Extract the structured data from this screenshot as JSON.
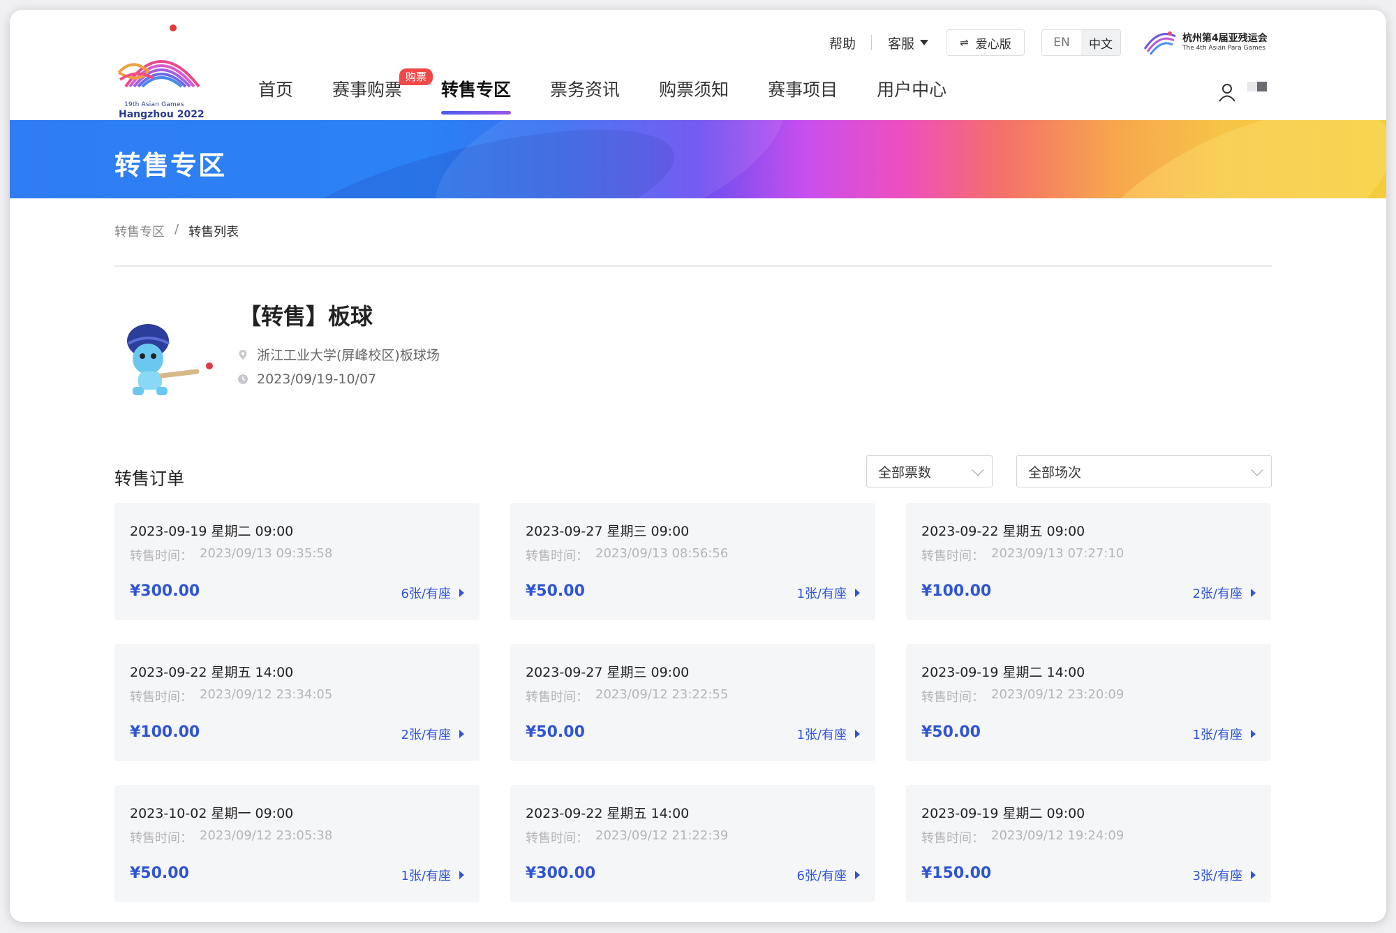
{
  "header": {
    "logo_line1": "19th Asian Games",
    "logo_line2": "Hangzhou 2022",
    "help_label": "帮助",
    "service_label": "客服",
    "love_label": "爱心版",
    "lang_en": "EN",
    "lang_cn": "中文",
    "para_games_cn": "杭州第4届亚残运会",
    "para_games_en": "The 4th Asian Para Games"
  },
  "nav": {
    "items": [
      {
        "label": "首页"
      },
      {
        "label": "赛事购票",
        "badge": "购票"
      },
      {
        "label": "转售专区"
      },
      {
        "label": "票务资讯"
      },
      {
        "label": "购票须知"
      },
      {
        "label": "赛事项目"
      },
      {
        "label": "用户中心"
      }
    ],
    "active": "转售专区"
  },
  "banner": {
    "title": "转售专区"
  },
  "breadcrumb": {
    "root": "转售专区",
    "separator": "/",
    "current": "转售列表"
  },
  "event": {
    "title": "【转售】板球",
    "venue": "浙江工业大学(屏峰校区)板球场",
    "dates": "2023/09/19-10/07"
  },
  "orders": {
    "section_title": "转售订单",
    "filter_count": "全部票数",
    "filter_session": "全部场次",
    "time_label": "转售时间：",
    "cards": [
      {
        "date": "2023-09-19 星期二 09:00",
        "sale_time": "2023/09/13 09:35:58",
        "price": "¥300.00",
        "qty": "6张/有座"
      },
      {
        "date": "2023-09-27 星期三 09:00",
        "sale_time": "2023/09/13 08:56:56",
        "price": "¥50.00",
        "qty": "1张/有座"
      },
      {
        "date": "2023-09-22 星期五 09:00",
        "sale_time": "2023/09/13 07:27:10",
        "price": "¥100.00",
        "qty": "2张/有座"
      },
      {
        "date": "2023-09-22 星期五 14:00",
        "sale_time": "2023/09/12 23:34:05",
        "price": "¥100.00",
        "qty": "2张/有座"
      },
      {
        "date": "2023-09-27 星期三 09:00",
        "sale_time": "2023/09/12 23:22:55",
        "price": "¥50.00",
        "qty": "1张/有座"
      },
      {
        "date": "2023-09-19 星期二 14:00",
        "sale_time": "2023/09/12 23:20:09",
        "price": "¥50.00",
        "qty": "1张/有座"
      },
      {
        "date": "2023-10-02 星期一 09:00",
        "sale_time": "2023/09/12 23:05:38",
        "price": "¥50.00",
        "qty": "1张/有座"
      },
      {
        "date": "2023-09-22 星期五 14:00",
        "sale_time": "2023/09/12 21:22:39",
        "price": "¥300.00",
        "qty": "6张/有座"
      },
      {
        "date": "2023-09-19 星期二 09:00",
        "sale_time": "2023/09/12 19:24:09",
        "price": "¥150.00",
        "qty": "3张/有座"
      }
    ]
  },
  "colors": {
    "accent": "#2f55d4",
    "badge": "#f04848",
    "card_bg": "#f5f6f8"
  }
}
